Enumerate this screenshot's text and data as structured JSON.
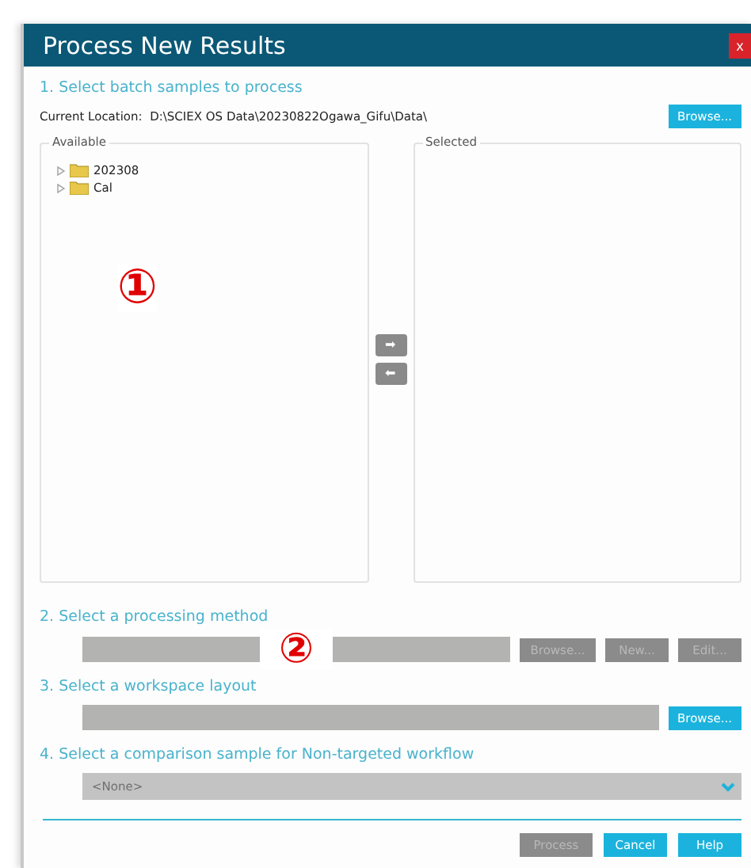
{
  "window": {
    "title": "Process New Results",
    "close": "x"
  },
  "step1": {
    "heading": "1. Select batch samples to process",
    "location_label": "Current Location:",
    "location": "D:\\SCIEX OS Data\\20230822Ogawa_Gifu\\Data\\",
    "browse": "Browse...",
    "available": {
      "label": "Available",
      "items": [
        {
          "name": "202308",
          "expanded": false
        },
        {
          "name": "Cal",
          "expanded": false
        }
      ]
    },
    "selected": {
      "label": "Selected"
    },
    "add_button": "➡",
    "remove_button": "⬅"
  },
  "annotations": [
    "①",
    "②"
  ],
  "step2": {
    "heading": "2. Select a processing method",
    "buttons": [
      {
        "label": "Browse...",
        "disabled": true
      },
      {
        "label": "New...",
        "disabled": true
      },
      {
        "label": "Edit...",
        "disabled": true
      }
    ]
  },
  "step3": {
    "heading": "3. Select a workspace layout",
    "buttons": [
      {
        "label": "Browse...",
        "disabled": false
      }
    ]
  },
  "step4": {
    "heading": "4. Select a comparison sample for Non-targeted workflow",
    "value": "<None>"
  },
  "footer": [
    {
      "label": "Process",
      "disabled": true
    },
    {
      "label": "Cancel",
      "disabled": false
    },
    {
      "label": "Help",
      "disabled": false
    }
  ]
}
